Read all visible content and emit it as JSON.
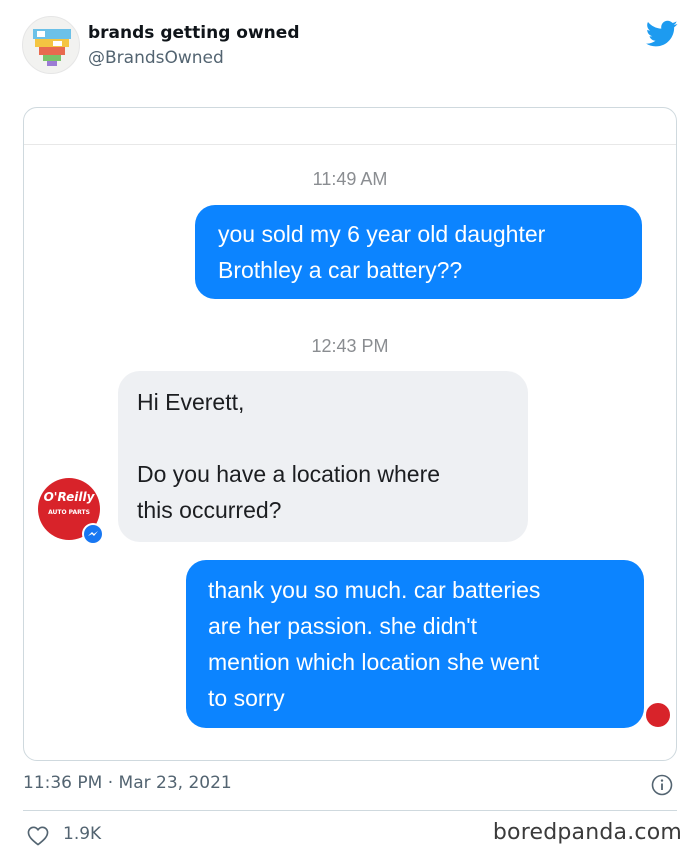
{
  "tweet": {
    "display_name": "brands getting owned",
    "handle": "@BrandsOwned",
    "posted_time": "11:36 PM · Mar 23, 2021",
    "like_count": "1.9K",
    "icons": {
      "brand": "twitter-bird-icon",
      "info": "info-icon",
      "like": "heart-icon"
    },
    "colors": {
      "twitter_blue": "#1d9bf0",
      "secondary_text": "#536471"
    }
  },
  "conversation": {
    "messages": [
      {
        "kind": "timestamp",
        "text": "11:49 AM"
      },
      {
        "kind": "outgoing",
        "text": "you sold my 6 year old daughter\nBrothley a car battery??"
      },
      {
        "kind": "timestamp",
        "text": "12:43 PM"
      },
      {
        "kind": "incoming",
        "text": "Hi Everett,\n\nDo you have a location where\nthis occurred?"
      },
      {
        "kind": "outgoing",
        "text": "thank you so much. car batteries\nare her passion. she didn't\nmention which location she went\nto sorry"
      }
    ],
    "brand_logo_text": "O'Reilly",
    "brand_logo_subtext": "AUTO PARTS",
    "colors": {
      "outgoing_bubble": "#0c84ff",
      "incoming_bubble": "#eef0f3",
      "brand_red": "#d8232a",
      "messenger_blue": "#1877f2"
    }
  },
  "watermark": "boredpanda.com"
}
